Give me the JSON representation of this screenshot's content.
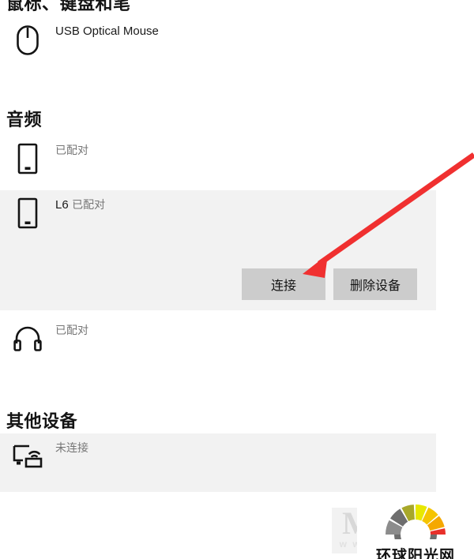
{
  "sections": {
    "mouse_keyboard": {
      "title": "鼠标、键盘和笔",
      "devices": [
        {
          "name": "USB Optical Mouse",
          "status": "",
          "icon": "mouse-icon"
        }
      ]
    },
    "audio": {
      "title": "音频",
      "devices": [
        {
          "name": "",
          "status": "已配对",
          "icon": "phone-icon",
          "redacted": true
        },
        {
          "name": "L6",
          "status": "已配对",
          "icon": "phone-icon",
          "redacted": false
        },
        {
          "name": "",
          "status": "已配对",
          "icon": "headphones-icon",
          "redacted": true
        }
      ]
    },
    "other": {
      "title": "其他设备",
      "devices": [
        {
          "name": "",
          "status": "未连接",
          "icon": "wireless-display-icon",
          "redacted": true
        }
      ]
    }
  },
  "selected_device_actions": {
    "connect_label": "连接",
    "remove_label": "删除设备"
  },
  "annotation": {
    "arrow_color": "#f03030"
  },
  "watermark": {
    "letter": "M",
    "sub": "w w w",
    "logo_text": "环球阳光网",
    "colors": {
      "gray": "#8c8c8c",
      "dark_gray": "#6e6e6e",
      "olive": "#a8a82a",
      "yellow": "#e8e800",
      "gold": "#f5c400",
      "orange": "#f5a800",
      "red": "#e8302a",
      "arc": "#6e6e6e"
    }
  }
}
